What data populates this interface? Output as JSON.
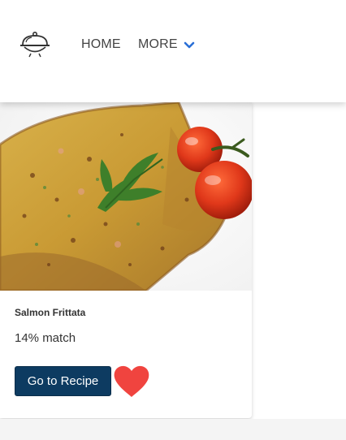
{
  "nav": {
    "logo_icon": "cloche-icon",
    "home_label": "HOME",
    "more_label": "MORE",
    "more_icon": "chevron-down-icon"
  },
  "recipe_card": {
    "image_alt": "Salmon Frittata",
    "title": "Salmon Frittata",
    "match": "14% match",
    "button_label": "Go to Recipe",
    "favorite_icon": "heart-icon"
  },
  "colors": {
    "button_bg": "#0d3b61",
    "heart": "#f0443f",
    "chevron": "#2a6fd6"
  }
}
